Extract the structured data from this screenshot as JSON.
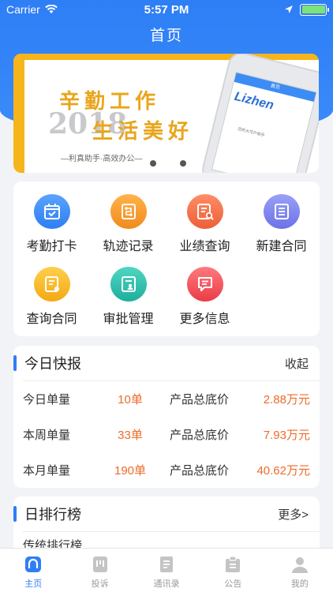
{
  "status_bar": {
    "carrier": "Carrier",
    "time": "5:57 PM"
  },
  "nav": {
    "title": "首页"
  },
  "banner": {
    "slogan_line1": "辛勤工作",
    "year": "2018",
    "slogan_line2": "生活美好",
    "tagline": "—利真助手·高效办公—",
    "phone_brand": "Lizhen",
    "phone_bar": "首页",
    "phone_sub": "您的大司户助手",
    "page_count": 2
  },
  "menu": {
    "items": [
      {
        "label": "考勤打卡",
        "icon": "calendar-check-icon",
        "color": "#3d8ef5"
      },
      {
        "label": "轨迹记录",
        "icon": "route-icon",
        "color": "#f39a2e"
      },
      {
        "label": "业绩查询",
        "icon": "chart-search-icon",
        "color": "#f2734d"
      },
      {
        "label": "新建合同",
        "icon": "document-list-icon",
        "color": "#7d84ef"
      },
      {
        "label": "查询合同",
        "icon": "document-edit-icon",
        "color": "#f6b62b"
      },
      {
        "label": "审批管理",
        "icon": "user-document-icon",
        "color": "#2fbfae"
      },
      {
        "label": "更多信息",
        "icon": "message-icon",
        "color": "#f0525a"
      }
    ]
  },
  "report": {
    "title": "今日快报",
    "toggle_label": "收起",
    "rows": [
      {
        "label": "今日单量",
        "count": "10单",
        "price_label": "产品总底价",
        "price": "2.88万元"
      },
      {
        "label": "本周单量",
        "count": "33单",
        "price_label": "产品总底价",
        "price": "7.93万元"
      },
      {
        "label": "本月单量",
        "count": "190单",
        "price_label": "产品总底价",
        "price": "40.62万元"
      }
    ]
  },
  "ranking": {
    "title": "日排行榜",
    "more_label": "更多>",
    "sub_title": "传统排行榜"
  },
  "tabbar": {
    "tabs": [
      {
        "label": "主页",
        "icon": "home-icon",
        "active": true
      },
      {
        "label": "投诉",
        "icon": "complaint-icon",
        "active": false
      },
      {
        "label": "通讯录",
        "icon": "contacts-icon",
        "active": false
      },
      {
        "label": "公告",
        "icon": "notice-icon",
        "active": false
      },
      {
        "label": "我的",
        "icon": "profile-icon",
        "active": false
      }
    ]
  },
  "colors": {
    "primary": "#2e7ef6",
    "accent_orange": "#ec6b2a",
    "banner_gold": "#e9a51b"
  }
}
